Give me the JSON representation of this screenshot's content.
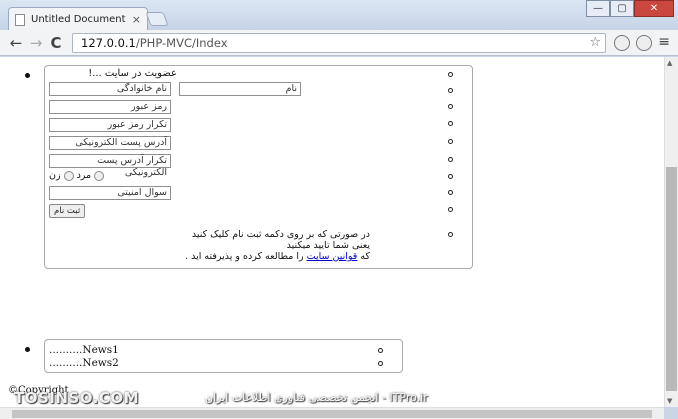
{
  "browser": {
    "tab_title": "Untitled Document",
    "tab_close": "×",
    "url_host": "127.0.0.1",
    "url_path": "/PHP-MVC/Index",
    "back": "←",
    "forward": "→",
    "reload": "C",
    "star": "☆",
    "menu": "≡",
    "window_controls": [
      "—",
      "▢",
      "✕"
    ]
  },
  "form": {
    "title": "عضویت در سایت ...!",
    "fields": {
      "first_name": "نام",
      "last_name": "نام خانوادگی",
      "password": "رمز عبور",
      "password_repeat": "تکرار رمز عبور",
      "email": "آدرس پست الکترونیکی",
      "email_repeat": "تکرار آدرس پست الکترونیکی",
      "security_question": "سوال امنیتی"
    },
    "gender_male": "مرد",
    "gender_female": "زن",
    "submit_label": "ثبت نام",
    "terms_line1": "در صورتی که بر روی دکمه ثبت نام کلیک کنید یعنی شما تایید میکنید",
    "terms_prefix": "که",
    "terms_link": "قوانین سایت",
    "terms_suffix": "را مطالعه کرده و پذیرفته اید ."
  },
  "news": {
    "items": [
      "..........News1",
      "..........News2"
    ]
  },
  "footer": {
    "copyright": "©Copyright"
  },
  "watermark": {
    "left": "TOSINSO.COM",
    "right": "ITPro.ir - انجمن تخصصی فناوری اطلاعات ایران"
  }
}
